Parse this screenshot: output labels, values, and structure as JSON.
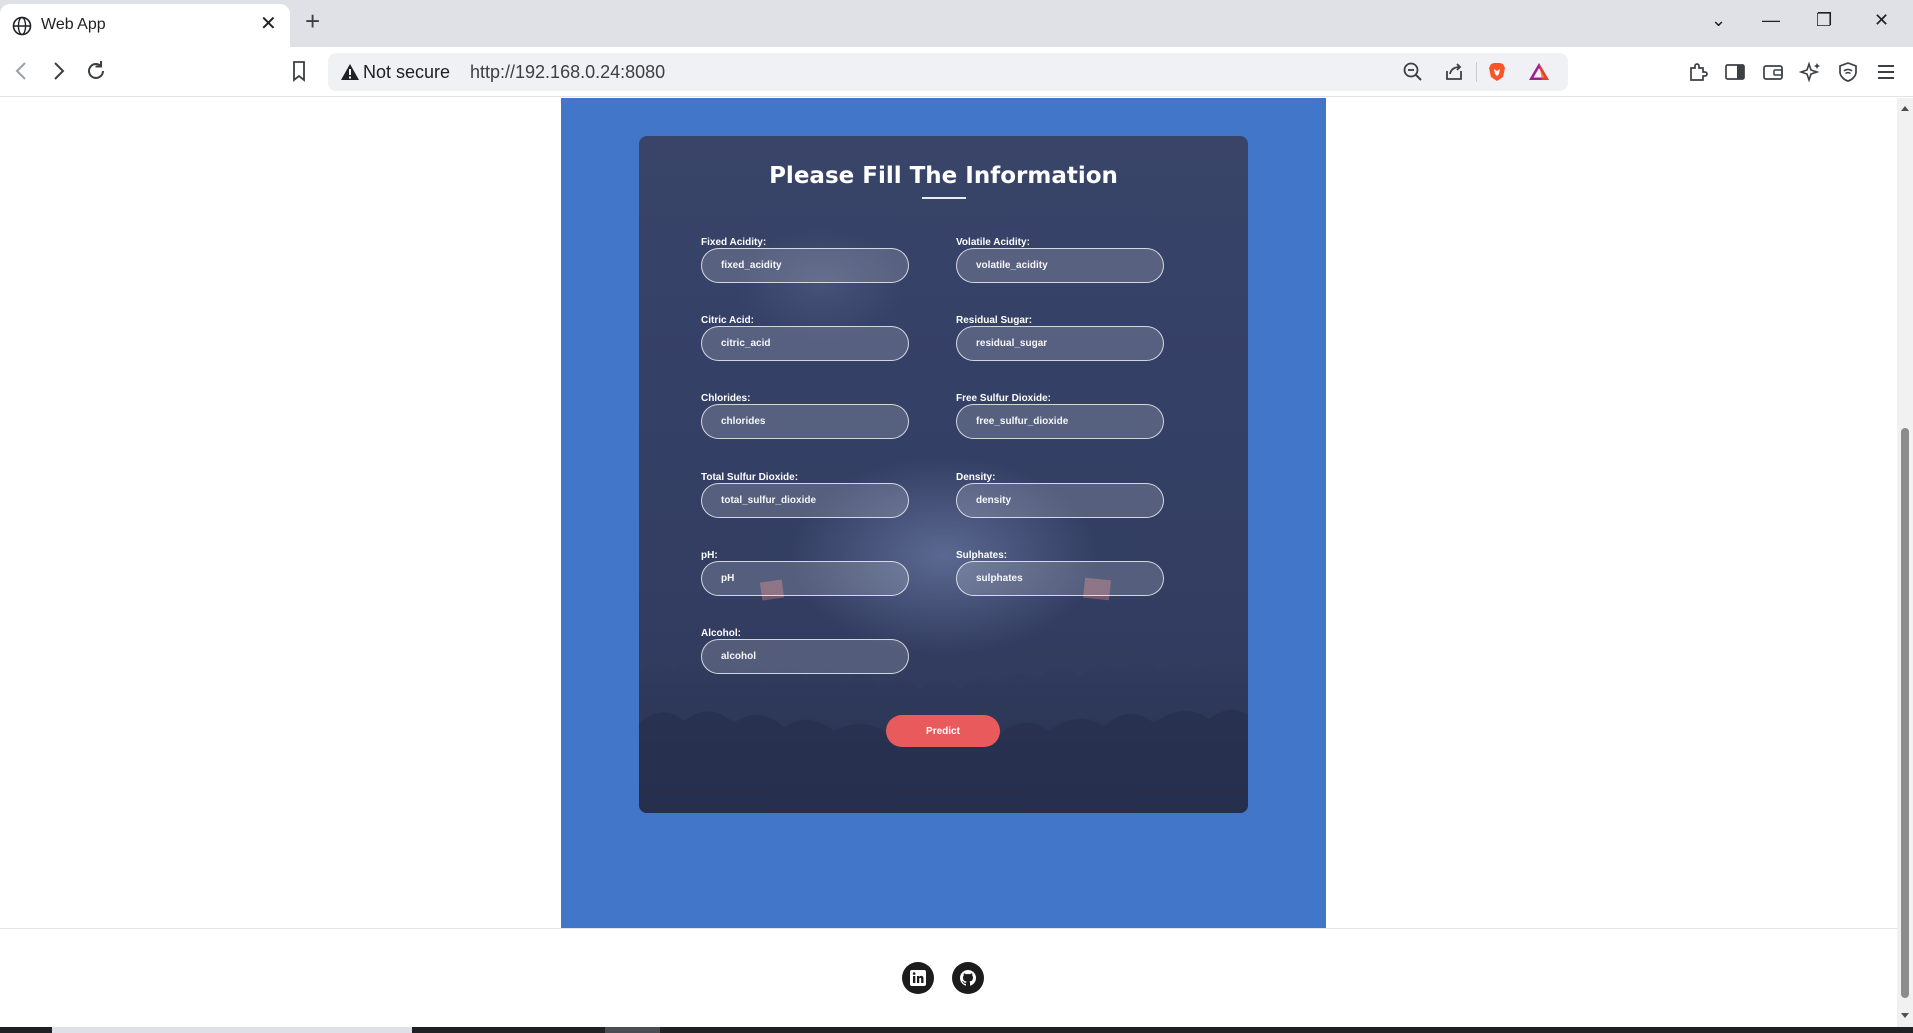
{
  "browser": {
    "tab_title": "Web App",
    "tab_close": "✕",
    "new_tab": "+",
    "security_label": "Not secure",
    "url": "http://192.168.0.24:8080",
    "window_controls": {
      "dropdown": "⌄",
      "minimize": "—",
      "restore": "❐",
      "close": "✕"
    }
  },
  "form": {
    "title": "Please Fill The Information",
    "fields": [
      {
        "label": "Fixed Acidity:",
        "placeholder": "fixed_acidity"
      },
      {
        "label": "Volatile Acidity:",
        "placeholder": "volatile_acidity"
      },
      {
        "label": "Citric Acid:",
        "placeholder": "citric_acid"
      },
      {
        "label": "Residual Sugar:",
        "placeholder": "residual_sugar"
      },
      {
        "label": "Chlorides:",
        "placeholder": "chlorides"
      },
      {
        "label": "Free Sulfur Dioxide:",
        "placeholder": "free_sulfur_dioxide"
      },
      {
        "label": "Total Sulfur Dioxide:",
        "placeholder": "total_sulfur_dioxide"
      },
      {
        "label": "Density:",
        "placeholder": "density"
      },
      {
        "label": "pH:",
        "placeholder": "pH"
      },
      {
        "label": "Sulphates:",
        "placeholder": "sulphates"
      },
      {
        "label": "Alcohol:",
        "placeholder": "alcohol"
      }
    ],
    "submit_label": "Predict"
  },
  "footer": {
    "social_icons": [
      "linkedin-icon",
      "github-icon"
    ]
  },
  "colors": {
    "panel_blue": "#4176c9",
    "card_navy": "#354067",
    "predict_red": "#e85a5c",
    "brave_orange": "#fb542b"
  }
}
